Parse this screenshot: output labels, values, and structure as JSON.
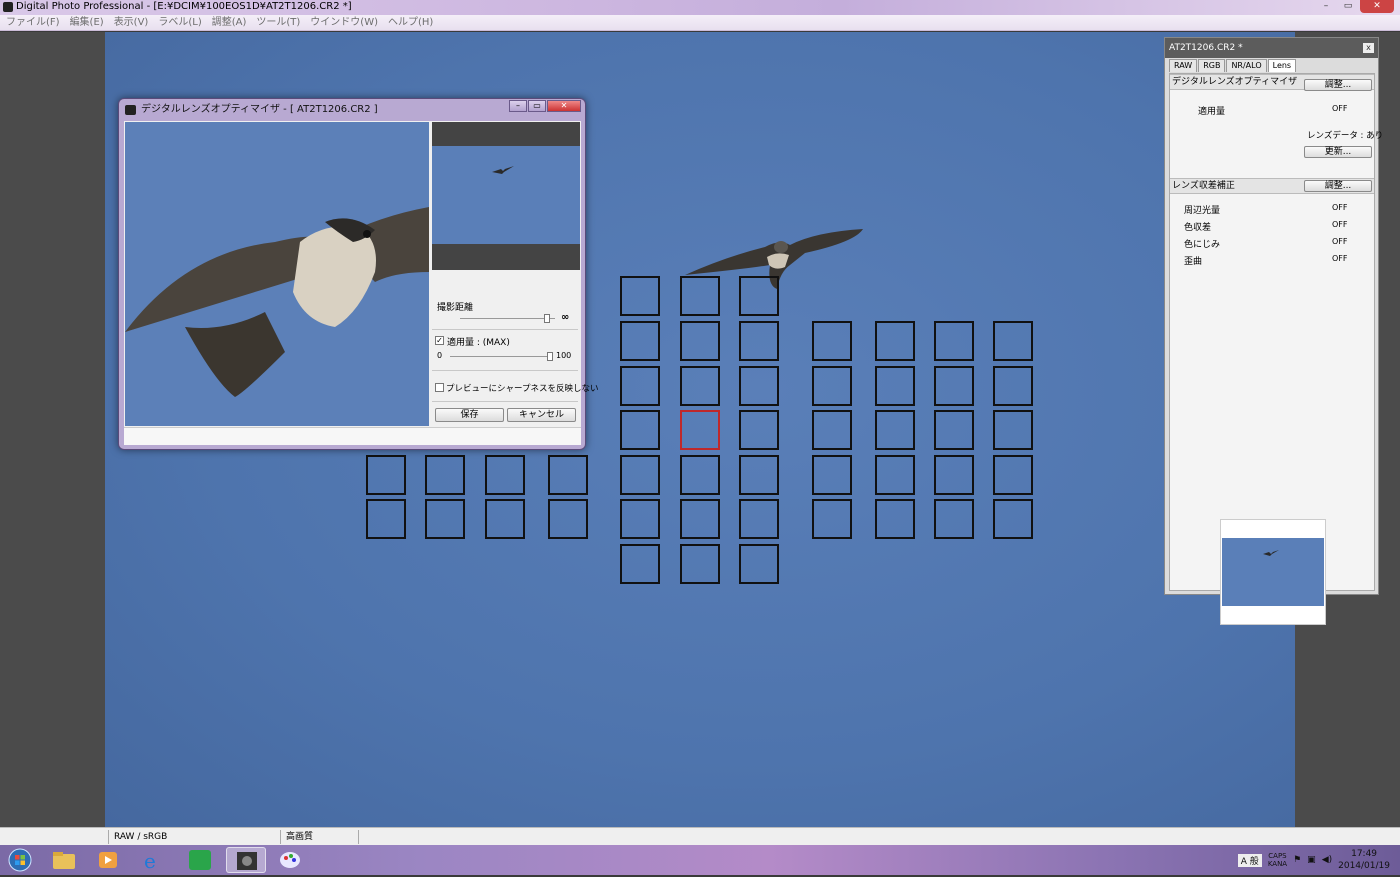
{
  "app": {
    "title": "Digital Photo Professional - [E:¥DCIM¥100EOS1D¥AT2T1206.CR2 *]"
  },
  "window_buttons": {
    "minimize": "–",
    "maximize": "▭",
    "close": "✕"
  },
  "menu": [
    "ファイル(F)",
    "編集(E)",
    "表示(V)",
    "ラベル(L)",
    "調整(A)",
    "ツール(T)",
    "ウインドウ(W)",
    "ヘルプ(H)"
  ],
  "dlo": {
    "title": "デジタルレンズオプティマイザ - [ AT2T1206.CR2 ]",
    "distance_label": "撮影距離",
    "distance_symbol": "∞",
    "apply_checked": true,
    "apply_label": "適用量 : (MAX)",
    "apply_min": "0",
    "apply_max": "100",
    "apply_value": 100,
    "sharpness_checked": false,
    "sharpness_label": "プレビューにシャープネスを反映しない",
    "save_label": "保存",
    "cancel_label": "キャンセル"
  },
  "tool": {
    "title": "AT2T1206.CR2 *",
    "close": "x",
    "tabs": [
      "RAW",
      "RGB",
      "NR/ALO",
      "Lens"
    ],
    "selected_tab": "Lens",
    "dlo_header": "デジタルレンズオプティマイザ",
    "adjust_label": "調整...",
    "apply_amount_label": "適用量",
    "apply_amount_value": "OFF",
    "lens_data_label": "レンズデータ : あり",
    "update_label": "更新...",
    "aberration_header": "レンズ収差補正",
    "aberration_adjust_label": "調整...",
    "aberration_rows": [
      {
        "label": "周辺光量",
        "value": "OFF"
      },
      {
        "label": "色収差",
        "value": "OFF"
      },
      {
        "label": "色にじみ",
        "value": "OFF"
      },
      {
        "label": "歪曲",
        "value": "OFF"
      }
    ]
  },
  "status": {
    "color": "RAW / sRGB",
    "quality": "高画質"
  },
  "taskbar": {
    "time": "17:49",
    "date": "2014/01/19",
    "ime": "A 般",
    "caps": "CAPS",
    "kana": "KANA"
  },
  "colors": {
    "sky": "#5a7fb8",
    "af_active": "#c0282a",
    "dialog_frame": "#b8a9d2"
  }
}
